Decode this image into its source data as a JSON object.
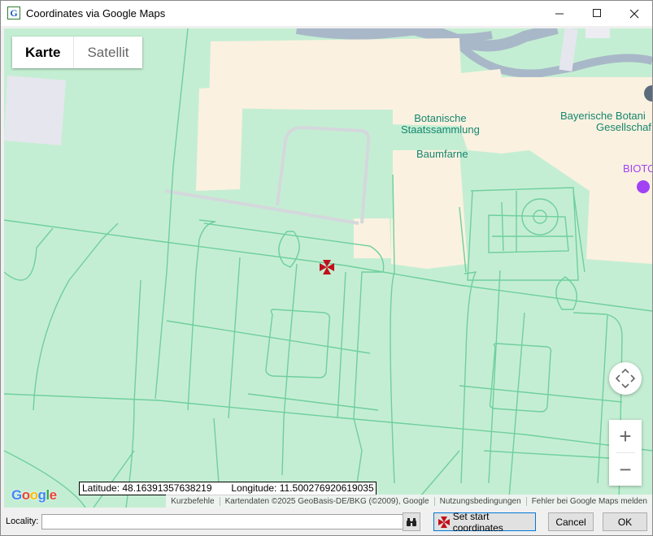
{
  "window": {
    "title": "Coordinates via Google Maps",
    "app_icon_letter": "G",
    "controls": {
      "minimize": "—",
      "maximize": "☐",
      "close": "✕"
    }
  },
  "map": {
    "map_type": {
      "map": "Karte",
      "satellite": "Satellit",
      "selected": "Karte"
    },
    "labels": {
      "botanische": "Botanische",
      "staatssammlung": "Staatssammlung",
      "baumfarne": "Baumfarne",
      "bayerische": "Bayerische Botani",
      "gesellschaft": "Gesellschaf",
      "biotop": "BIOTO"
    },
    "google_logo": "Google",
    "coords": {
      "latitude": "Latitude: 48.16391357638219",
      "longitude": "Longitude: 11.500276920619035"
    },
    "attribution": [
      "Kurzbefehle",
      "Kartendaten ©2025 GeoBasis-DE/BKG (©2009), Google",
      "Nutzungsbedingungen",
      "Fehler bei Google Maps melden"
    ],
    "zoom": {
      "in": "+",
      "out": "−"
    },
    "colors": {
      "park": "#c4eed3",
      "building": "#fbf1e0",
      "path": "#6fcf9e",
      "road": "#dcdce4",
      "water_road": "#a9b8c8",
      "marker": "#c0101a"
    }
  },
  "bottom": {
    "locality_label": "Locality:",
    "locality_value": "",
    "set_start": "Set start coordinates",
    "cancel": "Cancel",
    "ok": "OK"
  }
}
